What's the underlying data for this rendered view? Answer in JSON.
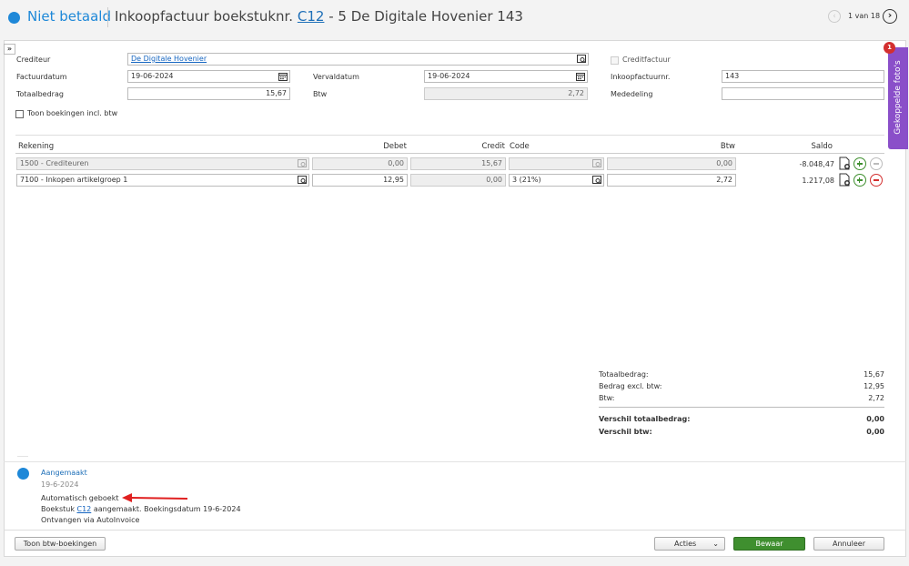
{
  "header": {
    "status": "Niet betaald",
    "title_prefix": "Inkoopfactuur boekstuknr.",
    "doc_link": "C12",
    "title_suffix": "- 5 De Digitale Hovenier 143",
    "pager": "1 van 18"
  },
  "form": {
    "crediteur_label": "Crediteur",
    "crediteur_value": "De Digitale Hovenier",
    "creditfactuur_label": "Creditfactuur",
    "factuurdatum_label": "Factuurdatum",
    "factuurdatum_value": "19-06-2024",
    "vervaldatum_label": "Vervaldatum",
    "vervaldatum_value": "19-06-2024",
    "inkoopfactuurnr_label": "Inkoopfactuurnr.",
    "inkoopfactuurnr_value": "143",
    "totaalbedrag_label": "Totaalbedrag",
    "totaalbedrag_value": "15,67",
    "btw_label": "Btw",
    "btw_value": "2,72",
    "mededeling_label": "Mededeling",
    "mededeling_value": "",
    "toon_incl_label": "Toon boekingen incl. btw"
  },
  "table": {
    "headers": [
      "Rekening",
      "Debet",
      "Credit",
      "Code",
      "Btw",
      "Saldo"
    ],
    "rows": [
      {
        "rekening": "1500 - Crediteuren",
        "debet": "0,00",
        "credit": "15,67",
        "code": "",
        "btw": "0,00",
        "saldo": "-8.048,47"
      },
      {
        "rekening": "7100 - Inkopen artikelgroep 1",
        "debet": "12,95",
        "credit": "0,00",
        "code": "3 (21%)",
        "btw": "2,72",
        "saldo": "1.217,08"
      }
    ]
  },
  "summary": {
    "totaalbedrag_label": "Totaalbedrag:",
    "totaalbedrag_value": "15,67",
    "excl_label": "Bedrag excl. btw:",
    "excl_value": "12,95",
    "btw_label": "Btw:",
    "btw_value": "2,72",
    "verschil_totaal_label": "Verschil totaalbedrag:",
    "verschil_totaal_value": "0,00",
    "verschil_btw_label": "Verschil btw:",
    "verschil_btw_value": "0,00"
  },
  "timeline": {
    "title": "Aangemaakt",
    "date": "19-6-2024",
    "line1": "Automatisch geboekt",
    "line2_prefix": "Boekstuk",
    "line2_link": "C12",
    "line2_suffix": "aangemaakt. Boekingsdatum 19-6-2024",
    "line3": "Ontvangen via AutoInvoice"
  },
  "side_tab": {
    "label": "Gekoppelde foto's",
    "badge": "1"
  },
  "footer": {
    "toon_btw": "Toon btw-boekingen",
    "acties": "Acties",
    "bewaar": "Bewaar",
    "annuleer": "Annuleer"
  },
  "colors": {
    "accent": "#1e88d8",
    "save": "#3f8f2f",
    "side_tab": "#8a4fc9",
    "remove": "#d32f2f"
  }
}
